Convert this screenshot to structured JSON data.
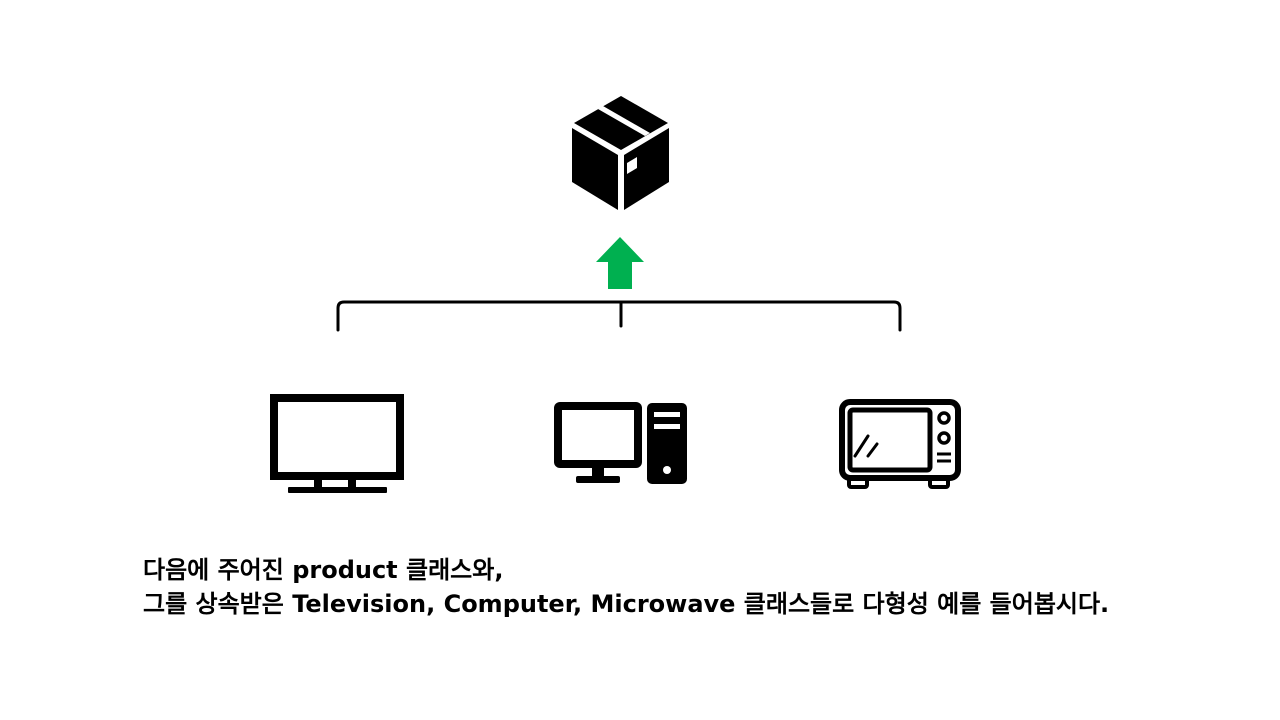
{
  "diagram": {
    "parent": {
      "icon": "package-box-icon"
    },
    "inheritance_arrow": {
      "icon": "arrow-up-icon",
      "color": "#00b050"
    },
    "children": [
      {
        "icon": "television-icon"
      },
      {
        "icon": "desktop-computer-icon"
      },
      {
        "icon": "microwave-icon"
      }
    ],
    "line_color": "#000000"
  },
  "caption": {
    "line1": "다음에 주어진 product 클래스와,",
    "line2": "그를 상속받은 Television, Computer, Microwave 클래스들로 다형성 예를 들어봅시다."
  }
}
